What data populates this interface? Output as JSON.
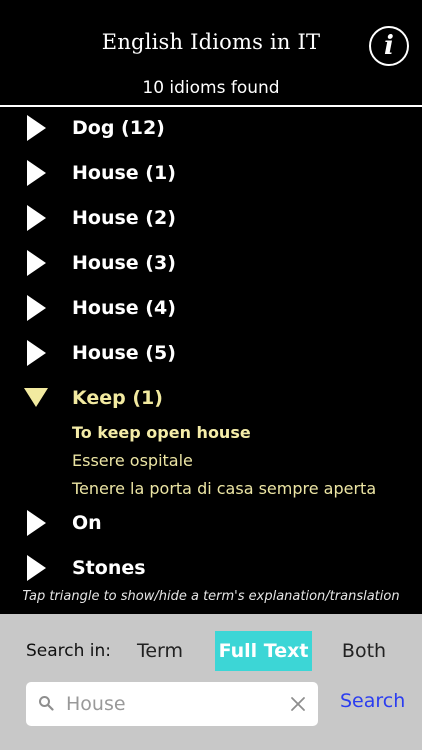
{
  "header": {
    "title": "English Idioms in IT",
    "info_icon": "i",
    "count_text": "10 idioms found"
  },
  "list": {
    "items": [
      {
        "label": "Dog (12)",
        "expanded": false
      },
      {
        "label": "House (1)",
        "expanded": false
      },
      {
        "label": "House (2)",
        "expanded": false
      },
      {
        "label": "House (3)",
        "expanded": false
      },
      {
        "label": "House (4)",
        "expanded": false
      },
      {
        "label": "House (5)",
        "expanded": false
      },
      {
        "label": "Keep (1)",
        "expanded": true,
        "detail": {
          "term": "To keep open house",
          "translations": [
            "Essere ospitale",
            "Tenere la porta di casa sempre aperta"
          ]
        }
      },
      {
        "label": "On",
        "expanded": false
      },
      {
        "label": "Stones",
        "expanded": false
      }
    ]
  },
  "hint": "Tap triangle to show/hide a term's explanation/translation",
  "search_panel": {
    "search_in_label": "Search in:",
    "options": [
      "Term",
      "Full Text",
      "Both"
    ],
    "selected_option": "Full Text",
    "input_value": "",
    "input_placeholder": "House",
    "search_button": "Search"
  },
  "colors": {
    "background": "#000000",
    "expanded_text": "#f2eaa0",
    "selected_option": "#3cd6d6",
    "panel": "#c8c8c8",
    "search_link": "#2b3df0"
  }
}
